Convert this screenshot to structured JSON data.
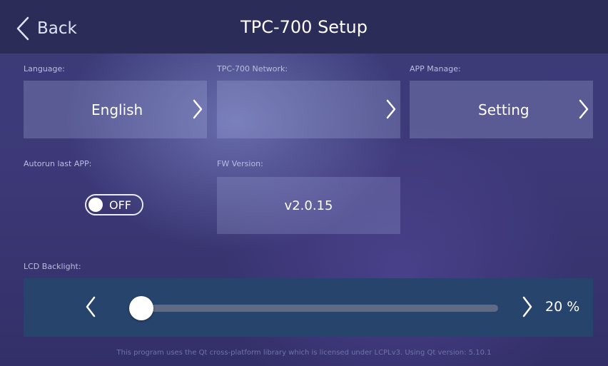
{
  "header": {
    "back_label": "Back",
    "title": "TPC-700 Setup"
  },
  "language": {
    "label": "Language:",
    "value": "English"
  },
  "network": {
    "label": "TPC-700 Network:",
    "value": ""
  },
  "app_manage": {
    "label": "APP Manage:",
    "value": "Setting"
  },
  "autorun": {
    "label": "Autorun last APP:",
    "state": "OFF"
  },
  "fw_version": {
    "label": "FW Version:",
    "value": "v2.0.15"
  },
  "backlight": {
    "label": "LCD Backlight:",
    "percent_text": "20 %",
    "level": 0.0
  },
  "footer": {
    "text": "This program uses the Qt cross-platform library which is licensed under LCPLv3. Using Qt version: 5.10.1"
  },
  "icons": {
    "back": "chevron-left-icon",
    "next": "chevron-right-icon"
  },
  "colors": {
    "header_bg": "#2b2c58",
    "tile_bg": "rgba(170,178,228,0.28)",
    "backlight_bar_bg": "#27446c",
    "label_text": "#b9bde0"
  }
}
